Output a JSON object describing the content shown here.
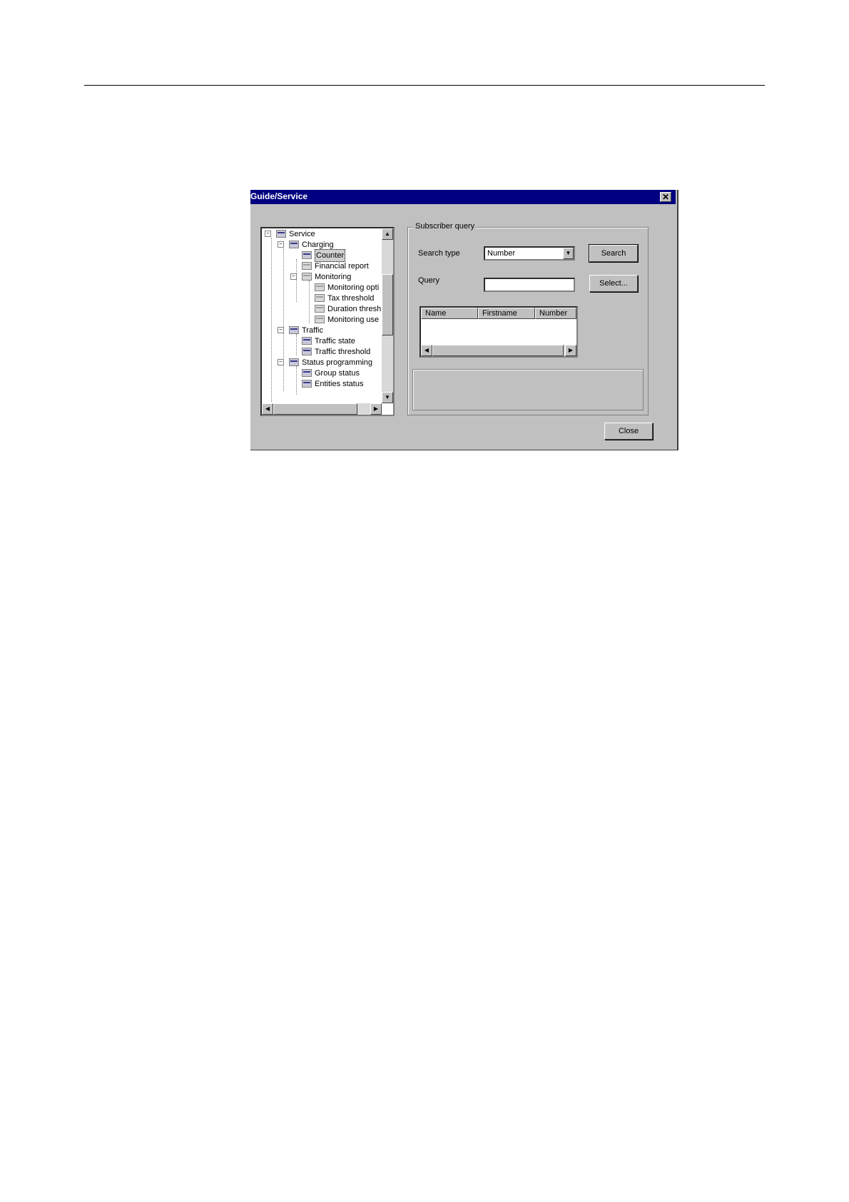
{
  "window": {
    "title": "Guide/Service",
    "close_glyph": "✕"
  },
  "tree": {
    "items": [
      {
        "label": "Service",
        "expander": "−"
      },
      {
        "label": "Charging",
        "expander": "−"
      },
      {
        "label": "Counter",
        "selected": true
      },
      {
        "label": "Financial report"
      },
      {
        "label": "Monitoring",
        "expander": "−"
      },
      {
        "label": "Monitoring opti"
      },
      {
        "label": "Tax threshold"
      },
      {
        "label": "Duration thresh"
      },
      {
        "label": "Monitoring use"
      },
      {
        "label": "Traffic",
        "expander": "−"
      },
      {
        "label": "Traffic state"
      },
      {
        "label": "Traffic threshold"
      },
      {
        "label": "Status programming",
        "expander": "−"
      },
      {
        "label": "Group status"
      },
      {
        "label": "Entities status"
      }
    ],
    "arrows": {
      "up": "▲",
      "down": "▼",
      "left": "◀",
      "right": "▶"
    }
  },
  "subscriber_query": {
    "title": "Subscriber query",
    "search_type_label": "Search type",
    "search_type_value": "Number",
    "search_button": "Search",
    "query_label": "Query",
    "query_value": "",
    "select_button": "Select...",
    "columns": [
      "Name",
      "Firstname",
      "Number"
    ]
  },
  "footer": {
    "close_button": "Close"
  }
}
